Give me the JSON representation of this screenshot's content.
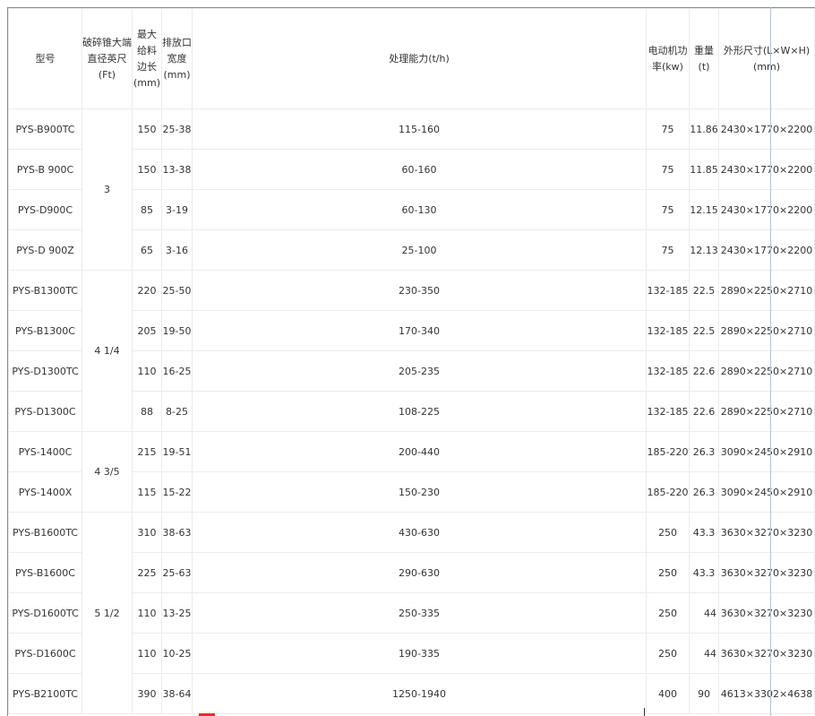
{
  "headers": {
    "model": "型号",
    "cone_diameter": "破碎锥大端直径英尺(Ft)",
    "max_feed": "最大给料边长(mm)",
    "discharge": "排放口宽度(mm)",
    "capacity": "处理能力(t/h)",
    "motor": "电动机功率(kw)",
    "weight": "重量(t)",
    "dimensions": "外形尺寸(L×W×H)(mm)"
  },
  "rows": [
    {
      "model": "PYS-B900TC",
      "feed": "150",
      "discharge": "25-38",
      "capacity": "115-160",
      "motor": "75",
      "weight": "11.86",
      "dims": "2430×1770×2200"
    },
    {
      "model": "PYS-B 900C",
      "feed": "150",
      "discharge": "13-38",
      "capacity": "60-160",
      "motor": "75",
      "weight": "11.85",
      "dims": "2430×1770×2200"
    },
    {
      "model": "PYS-D900C",
      "feed": "85",
      "discharge": "3-19",
      "capacity": "60-130",
      "motor": "75",
      "weight": "12.15",
      "dims": "2430×1770×2200"
    },
    {
      "model": "PYS-D 900Z",
      "feed": "65",
      "discharge": "3-16",
      "capacity": "25-100",
      "motor": "75",
      "weight": "12.13",
      "dims": "2430×1770×2200"
    },
    {
      "model": "PYS-B1300TC",
      "feed": "220",
      "discharge": "25-50",
      "capacity": "230-350",
      "motor": "132-185",
      "weight": "22.5",
      "dims": "2890×2250×2710"
    },
    {
      "model": "PYS-B1300C",
      "feed": "205",
      "discharge": "19-50",
      "capacity": "170-340",
      "motor": "132-185",
      "weight": "22.5",
      "dims": "2890×2250×2710"
    },
    {
      "model": "PYS-D1300TC",
      "feed": "110",
      "discharge": "16-25",
      "capacity": "205-235",
      "motor": "132-185",
      "weight": "22.6",
      "dims": "2890×2250×2710"
    },
    {
      "model": "PYS-D1300C",
      "feed": "88",
      "discharge": "8-25",
      "capacity": "108-225",
      "motor": "132-185",
      "weight": "22.6",
      "dims": "2890×2250×2710"
    },
    {
      "model": "PYS-1400C",
      "feed": "215",
      "discharge": "19-51",
      "capacity": "200-440",
      "motor": "185-220",
      "weight": "26.3",
      "dims": "3090×2450×2910"
    },
    {
      "model": "PYS-1400X",
      "feed": "115",
      "discharge": "15-22",
      "capacity": "150-230",
      "motor": "185-220",
      "weight": "26.3",
      "dims": "3090×2450×2910"
    },
    {
      "model": "PYS-B1600TC",
      "feed": "310",
      "discharge": "38-63",
      "capacity": "430-630",
      "motor": "250",
      "weight": "43.3",
      "dims": "3630×3270×3230"
    },
    {
      "model": "PYS-B1600C",
      "feed": "225",
      "discharge": "25-63",
      "capacity": "290-630",
      "motor": "250",
      "weight": "43.3",
      "dims": "3630×3270×3230"
    },
    {
      "model": "PYS-D1600TC",
      "feed": "110",
      "discharge": "13-25",
      "capacity": "250-335",
      "motor": "250",
      "weight": "44",
      "dims": "3630×3270×3230"
    },
    {
      "model": "PYS-D1600C",
      "feed": "110",
      "discharge": "10-25",
      "capacity": "190-335",
      "motor": "250",
      "weight": "44",
      "dims": "3630×3270×3230"
    },
    {
      "model": "PYS-B2100TC",
      "feed": "390",
      "discharge": "38-64",
      "capacity": "1250-1940",
      "motor": "400",
      "weight": "90",
      "dims": "4613×3302×4638"
    }
  ],
  "groups": [
    "3",
    "4 1/4",
    "4 3/5",
    "5 1/2"
  ]
}
